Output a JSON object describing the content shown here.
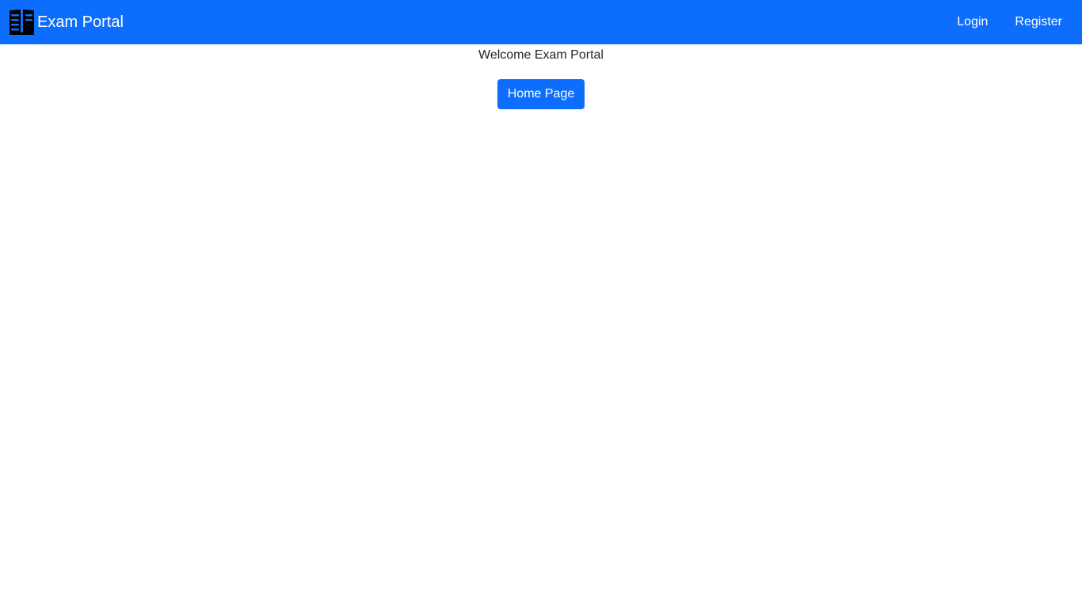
{
  "navbar": {
    "background_color": "#0d6efd",
    "brand": {
      "icon": "book-icon",
      "label": "Exam Portal"
    },
    "links": [
      {
        "label": "Login"
      },
      {
        "label": "Register"
      }
    ]
  },
  "main": {
    "welcome_text": "Welcome Exam Portal",
    "home_button_label": "Home Page",
    "accent_color": "#0d6efd"
  }
}
